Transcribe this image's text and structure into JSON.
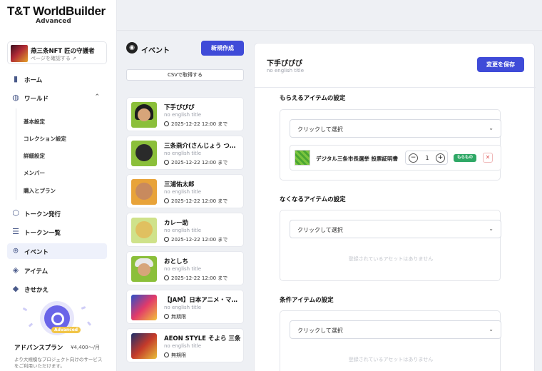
{
  "app": {
    "logo": "T&T WorldBuilder",
    "edition": "Advanced"
  },
  "project": {
    "name": "燕三条NFT 匠の守護者",
    "link": "ページを確認する"
  },
  "sidebar": {
    "items": [
      {
        "label": "ホーム",
        "icon": "bar-chart-icon"
      },
      {
        "label": "ワールド",
        "icon": "globe-icon"
      },
      {
        "label": "トークン発行",
        "icon": "cube-outline-icon"
      },
      {
        "label": "トークン一覧",
        "icon": "list-icon"
      },
      {
        "label": "イベント",
        "icon": "map-pin-icon"
      },
      {
        "label": "アイテム",
        "icon": "box-icon"
      },
      {
        "label": "きせかえ",
        "icon": "layers-icon"
      }
    ],
    "world_sub": [
      "基本設定",
      "コレクション設定",
      "詳細設定",
      "メンバー",
      "購入とプラン"
    ]
  },
  "promo": {
    "badge": "Advanced",
    "title": "アドバンスプラン",
    "price": "¥4,400〜/月",
    "desc": "より大規模なプロジェクト向けのサービスをご利用いただけます。"
  },
  "events": {
    "title": "イベント",
    "new_button": "新規作成",
    "csv_button": "CSVで取得する",
    "cards": [
      {
        "title": "下手ぴぴぴ",
        "subtitle": "no english title",
        "date": "2025-12-22 12:00 まで"
      },
      {
        "title": "三条燕介(さんじょう つばめすけ)",
        "subtitle": "no english title",
        "date": "2025-12-22 12:00 まで"
      },
      {
        "title": "三浦佑太郎",
        "subtitle": "no english title",
        "date": "2025-12-22 12:00 まで"
      },
      {
        "title": "カレー助",
        "subtitle": "no english title",
        "date": "2025-12-22 12:00 まで"
      },
      {
        "title": "おとしち",
        "subtitle": "no english title",
        "date": "2025-12-22 12:00 まで"
      },
      {
        "title": "【JAM】日本アニメ・マンガ",
        "subtitle": "no english title",
        "date": "無期限"
      },
      {
        "title": "AEON STYLE そよら 三条",
        "subtitle": "no english title",
        "date": "無期限"
      }
    ]
  },
  "detail": {
    "title": "下手ぴぴぴ",
    "subtitle": "no english title",
    "save_button": "変更を保存",
    "sections": [
      {
        "title": "もらえるアイテムの設定",
        "select": "クリックして選択"
      },
      {
        "title": "なくなるアイテムの設定",
        "select": "クリックして選択",
        "empty": "登録されているアセットはありません"
      },
      {
        "title": "条件アイテムの設定",
        "select": "クリックして選択",
        "empty": "登録されているアセットはありません"
      }
    ],
    "item": {
      "name": "デジタル三条市長選挙 投票証明書",
      "qty": "1",
      "tag": "もらもの"
    }
  },
  "colors": {
    "primary": "#3f4bd8",
    "success": "#2fa866",
    "danger": "#e05a5a"
  }
}
